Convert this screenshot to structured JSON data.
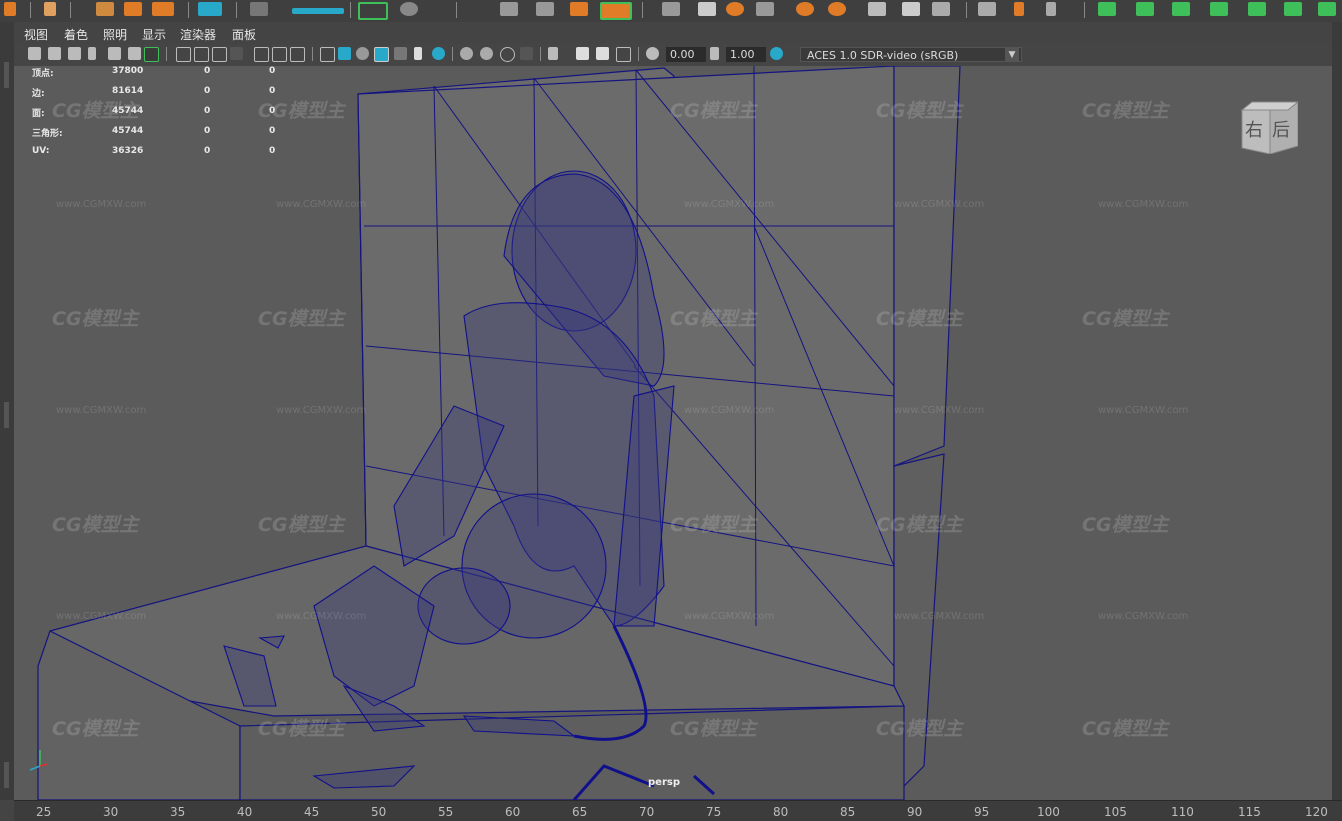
{
  "menu": {
    "items": [
      "视图",
      "着色",
      "照明",
      "显示",
      "渲染器",
      "面板"
    ]
  },
  "toolbar": {
    "exposure_value": "0.00",
    "gamma_value": "1.00",
    "color_space": "ACES 1.0 SDR-video (sRGB)"
  },
  "hud": {
    "rows": [
      {
        "label": "顶点:",
        "a": "37800",
        "b": "0",
        "c": "0"
      },
      {
        "label": "边:",
        "a": "81614",
        "b": "0",
        "c": "0"
      },
      {
        "label": "面:",
        "a": "45744",
        "b": "0",
        "c": "0"
      },
      {
        "label": "三角形:",
        "a": "45744",
        "b": "0",
        "c": "0"
      },
      {
        "label": "UV:",
        "a": "36326",
        "b": "0",
        "c": "0"
      }
    ]
  },
  "viewcube": {
    "right_label": "右",
    "back_label": "后"
  },
  "camera_label": "persp",
  "watermark": {
    "logo": "CG模型主",
    "url": "www.CGMXW.com"
  },
  "timeline": {
    "ticks": [
      "25",
      "30",
      "35",
      "40",
      "45",
      "50",
      "55",
      "60",
      "65",
      "70",
      "75",
      "80",
      "85",
      "90",
      "95",
      "100",
      "105",
      "110",
      "115",
      "120"
    ]
  },
  "colors": {
    "wireframe": "#10108c",
    "viewport_bg": "#5b5b5b",
    "accent_orange": "#e07b28",
    "accent_green": "#3fbf5a",
    "accent_cyan": "#29a9c9"
  }
}
